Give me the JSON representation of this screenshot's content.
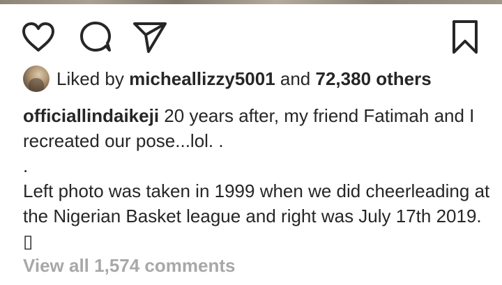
{
  "post": {
    "actions": {
      "like_icon": "heart-icon",
      "comment_icon": "comment-icon",
      "share_icon": "share-icon",
      "save_icon": "bookmark-icon"
    },
    "likes": {
      "prefix": "Liked by",
      "user": "micheallizzy5001",
      "connector": "and",
      "others": "72,380 others"
    },
    "caption": {
      "author": "officiallindaikeji",
      "line1_text": "20 years after, my friend Fatimah and I recreated our pose...lol. .",
      "dot_line": ".",
      "paragraph2": "Left photo was taken in 1999 when we did cheerleading at the Nigerian Basket league and right was July 17th 2019. ▯"
    },
    "comments_link": "View all 1,574 comments"
  },
  "colors": {
    "text": "#262626",
    "muted": "#a8a8a8",
    "icon": "#262626"
  }
}
